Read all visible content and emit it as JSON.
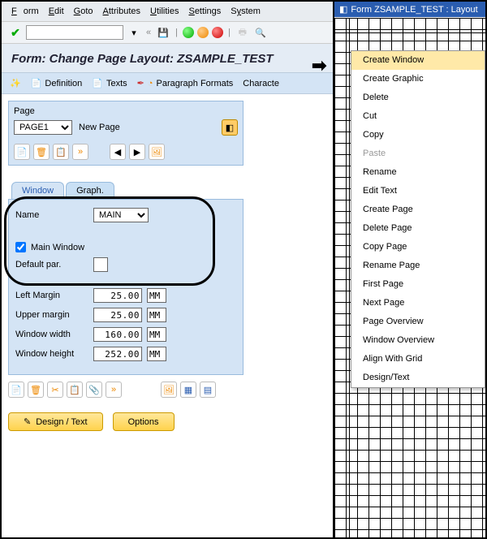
{
  "menubar": [
    "Form",
    "Edit",
    "Goto",
    "Attributes",
    "Utilities",
    "Settings",
    "System"
  ],
  "title": "Form: Change Page Layout: ZSAMPLE_TEST",
  "subtoolbar": {
    "definition": "Definition",
    "texts": "Texts",
    "paragraph": "Paragraph Formats",
    "character": "Characte"
  },
  "page_panel": {
    "label": "Page",
    "selected": "PAGE1",
    "new_page": "New Page"
  },
  "tabs": {
    "window": "Window",
    "graph": "Graph."
  },
  "window_tab": {
    "name_label": "Name",
    "name_value": "MAIN",
    "main_window_label": "Main Window",
    "main_window_checked": true,
    "default_par_label": "Default par.",
    "left_margin_label": "Left Margin",
    "left_margin_value": "25.00",
    "left_margin_unit": "MM",
    "upper_margin_label": "Upper margin",
    "upper_margin_value": "25.00",
    "upper_margin_unit": "MM",
    "window_width_label": "Window width",
    "window_width_value": "160.00",
    "window_width_unit": "MM",
    "window_height_label": "Window height",
    "window_height_value": "252.00",
    "window_height_unit": "MM"
  },
  "bottom_buttons": {
    "design": "Design / Text",
    "options": "Options"
  },
  "dock_title": "Form ZSAMPLE_TEST : Layout",
  "context_menu": [
    {
      "label": "Create Window",
      "hl": true
    },
    {
      "label": "Create Graphic"
    },
    {
      "label": "Delete"
    },
    {
      "label": "Cut"
    },
    {
      "label": "Copy"
    },
    {
      "label": "Paste",
      "disabled": true
    },
    {
      "label": "Rename"
    },
    {
      "label": "Edit Text"
    },
    {
      "label": "Create Page"
    },
    {
      "label": "Delete Page"
    },
    {
      "label": "Copy Page"
    },
    {
      "label": "Rename Page"
    },
    {
      "label": "First Page"
    },
    {
      "label": "Next Page"
    },
    {
      "label": "Page Overview"
    },
    {
      "label": "Window Overview"
    },
    {
      "label": "Align With Grid"
    },
    {
      "label": "Design/Text"
    }
  ]
}
